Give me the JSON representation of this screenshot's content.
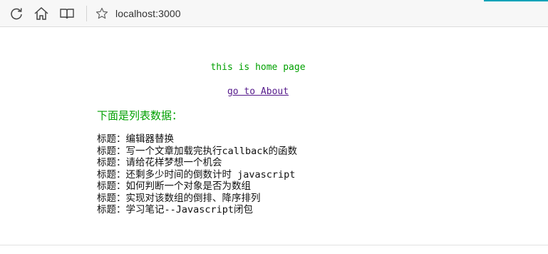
{
  "browser": {
    "url": "localhost:3000",
    "accent_color": "#00a2b8",
    "icons": {
      "refresh": "refresh-icon",
      "home": "home-icon",
      "reading_view": "book-icon",
      "favorite": "star-icon"
    }
  },
  "page": {
    "home_text": "this is home page",
    "about_link": "go to About",
    "list_heading": "下面是列表数据：",
    "text_color": "#00a000",
    "link_color": "#551a8b",
    "items": [
      "标题：编辑器替换",
      "标题：写一个文章加载完执行callback的函数",
      "标题：请给花样梦想一个机会",
      "标题：还剩多少时间的倒数计时 javascript",
      "标题：如何判断一个对象是否为数组",
      "标题：实现对该数组的倒排、降序排列",
      "标题：学习笔记--Javascript闭包"
    ]
  }
}
